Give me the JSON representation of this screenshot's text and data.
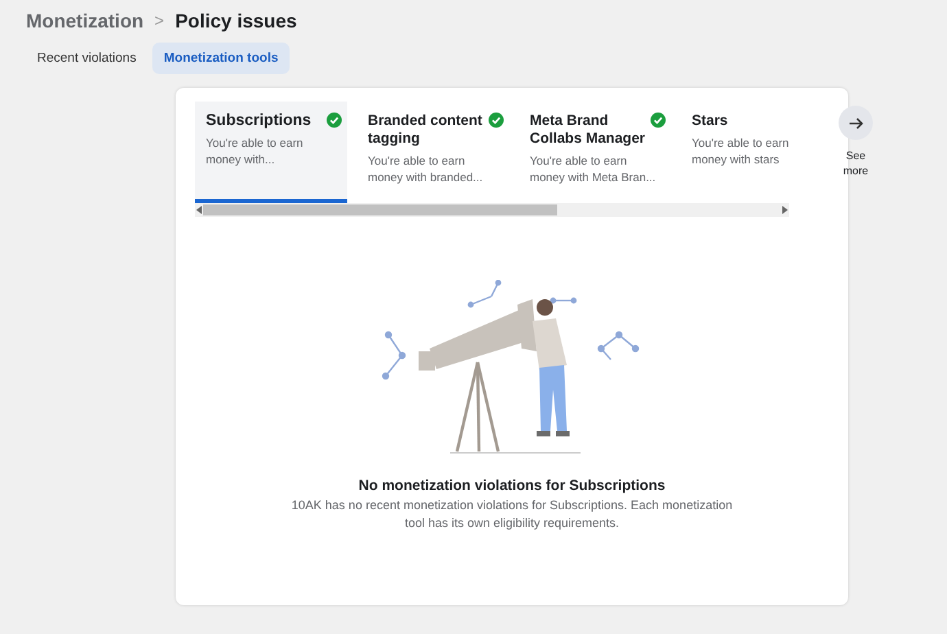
{
  "breadcrumb": {
    "parent": "Monetization",
    "separator": ">",
    "current": "Policy issues"
  },
  "tabs": [
    {
      "label": "Recent violations",
      "selected": false
    },
    {
      "label": "Monetization tools",
      "selected": true
    }
  ],
  "tools": [
    {
      "title": "Subscriptions",
      "description": "You're able to earn money with...",
      "eligible": true,
      "selected": true
    },
    {
      "title": "Branded content tagging",
      "description": "You're able to earn money with branded...",
      "eligible": true,
      "selected": false
    },
    {
      "title": "Meta Brand Collabs Manager",
      "description": "You're able to earn money with Meta Bran...",
      "eligible": true,
      "selected": false
    },
    {
      "title": "Stars",
      "description": "You're able to earn money with stars",
      "eligible": false,
      "selected": false
    }
  ],
  "see_more": {
    "label": "See more"
  },
  "empty_state": {
    "title": "No monetization violations for Subscriptions",
    "description": "10AK has no recent monetization violations for Subscriptions. Each monetization tool has its own eligibility requirements."
  }
}
